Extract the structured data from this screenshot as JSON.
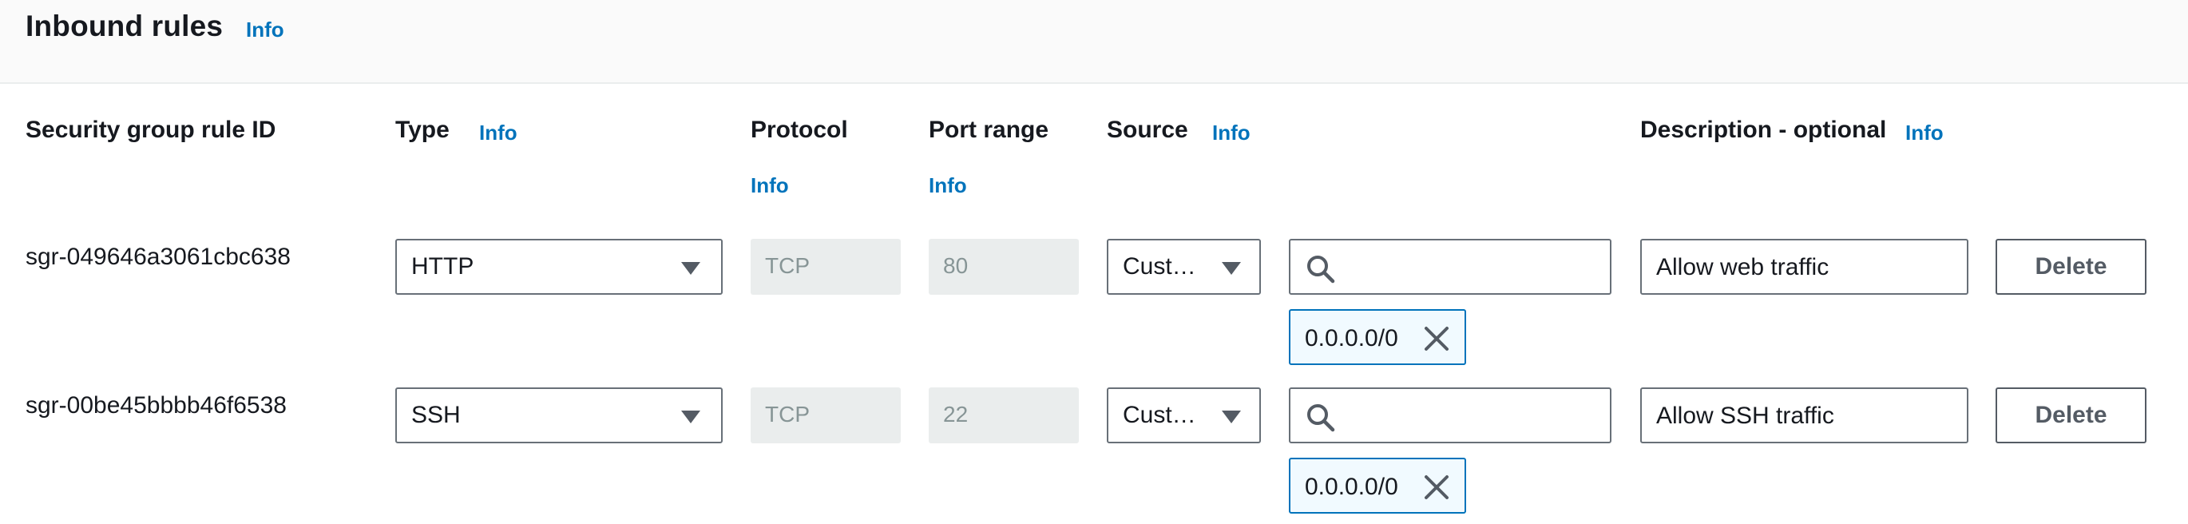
{
  "section": {
    "title": "Inbound rules",
    "info": "Info"
  },
  "columns": {
    "rule_id": "Security group rule ID",
    "type": "Type",
    "type_info": "Info",
    "protocol": "Protocol",
    "protocol_info": "Info",
    "port_range": "Port range",
    "port_range_info": "Info",
    "source": "Source",
    "source_info": "Info",
    "description": "Description - optional",
    "description_info": "Info"
  },
  "rules": [
    {
      "id": "sgr-049646a3061cbc638",
      "type": "HTTP",
      "protocol": "TCP",
      "port": "80",
      "source_type": "Cust…",
      "cidr": "0.0.0.0/0",
      "description": "Allow web traffic",
      "delete_label": "Delete"
    },
    {
      "id": "sgr-00be45bbbb46f6538",
      "type": "SSH",
      "protocol": "TCP",
      "port": "22",
      "source_type": "Cust…",
      "cidr": "0.0.0.0/0",
      "description": "Allow SSH traffic",
      "delete_label": "Delete"
    }
  ],
  "icons": {
    "select_caret": "caret-down-icon",
    "search": "search-icon",
    "remove_token": "close-icon"
  },
  "colors": {
    "link": "#0073bb",
    "token_border": "#0073bb",
    "token_bg": "#f1faff",
    "disabled_bg": "#eaeded"
  }
}
